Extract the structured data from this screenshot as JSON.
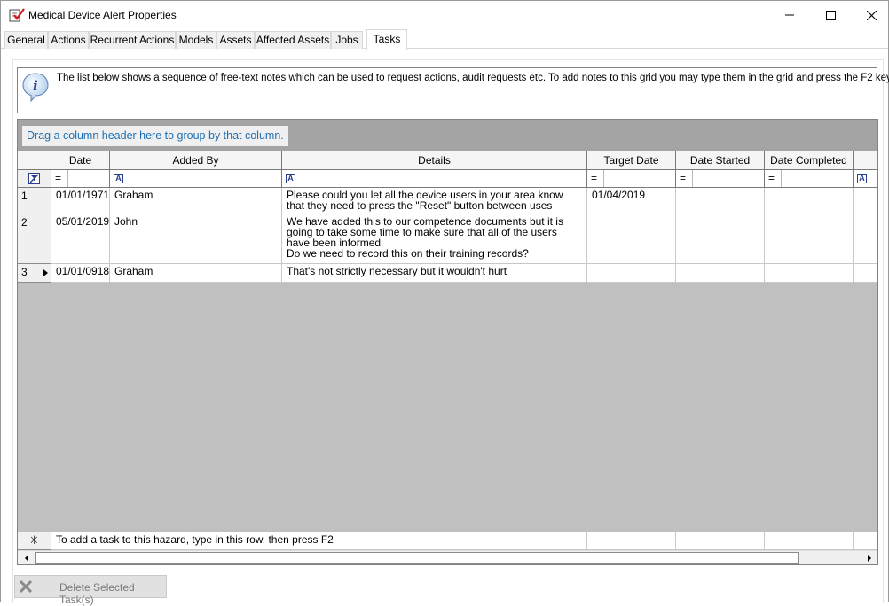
{
  "window": {
    "title": "Medical Device Alert Properties"
  },
  "tabs": [
    {
      "label": "General"
    },
    {
      "label": "Actions"
    },
    {
      "label": "Recurrent Actions"
    },
    {
      "label": "Models"
    },
    {
      "label": "Assets"
    },
    {
      "label": "Affected Assets"
    },
    {
      "label": "Jobs"
    },
    {
      "label": "Tasks",
      "active": true
    }
  ],
  "info": {
    "icon": "info-icon",
    "text": "The list below shows a sequence of free-text notes which can be used to request actions, audit requests etc. To add notes to this grid you may type them in the grid and press the F2 key"
  },
  "grid": {
    "group_hint": "Drag a column header here to group by that column.",
    "columns": [
      {
        "label": "Date"
      },
      {
        "label": "Added By"
      },
      {
        "label": "Details"
      },
      {
        "label": "Target Date"
      },
      {
        "label": "Date Started"
      },
      {
        "label": "Date Completed"
      }
    ],
    "filter_ops": {
      "eq": "=",
      "text": "A"
    },
    "rows": [
      {
        "num": "1",
        "date": "01/01/1971",
        "added_by": "Graham",
        "details": "Please could you let all the device users in your area know that they need to press the \"Reset\" button between uses",
        "target": "01/04/2019",
        "started": "",
        "completed": ""
      },
      {
        "num": "2",
        "date": "05/01/2019",
        "added_by": "John",
        "details": "We have added this to our competence documents but it is going to take some time to make sure that all of the users have been informed\nDo we need to record this on their training records?",
        "target": "",
        "started": "",
        "completed": ""
      },
      {
        "num": "3",
        "date": "01/01/0918",
        "added_by": "Graham",
        "details": "That's not strictly necessary but it wouldn't hurt",
        "target": "",
        "started": "",
        "completed": "",
        "current": true
      }
    ],
    "new_row_hint": "To add a task to this hazard, type in this row, then press F2",
    "new_row_marker": "✳"
  },
  "footer": {
    "delete_label": "Delete Selected Task(s)"
  }
}
